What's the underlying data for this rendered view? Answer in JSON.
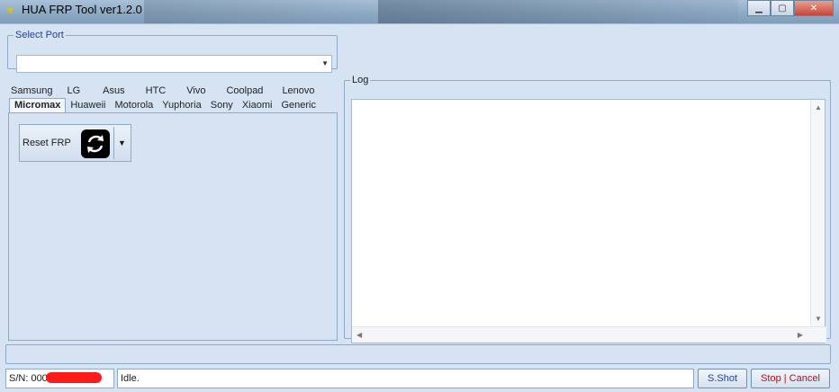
{
  "window": {
    "title": "HUA FRP Tool ver1.2.0",
    "buttons": [
      "minimize",
      "maximize",
      "close"
    ]
  },
  "select_port": {
    "legend": "Select Port",
    "value": ""
  },
  "brand_tabs": {
    "row1": [
      "Samsung",
      "LG",
      "Asus",
      "HTC",
      "Vivo",
      "Coolpad",
      "Lenovo"
    ],
    "row2": [
      "Micromax",
      "Huaweii",
      "Motorola",
      "Yuphoria",
      "Sony",
      "Xiaomi",
      "Generic"
    ],
    "active": "Micromax"
  },
  "panel": {
    "reset_frp_label": "Reset FRP"
  },
  "log": {
    "legend": "Log",
    "content": ""
  },
  "status_bar": {
    "serial": "S/N: 00010003",
    "status": "Idle.",
    "sshot_label": "S.Shot",
    "stop_cancel_label": "Stop | Cancel"
  },
  "colors": {
    "background": "#d6e3f2",
    "accent": "#1f3fa0",
    "redaction": "#ff1a1a"
  }
}
